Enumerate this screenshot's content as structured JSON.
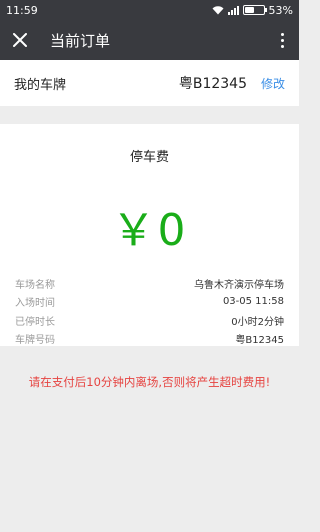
{
  "status_bar": {
    "time": "11:59",
    "battery": "53%",
    "battery_level": 0.53
  },
  "nav": {
    "title": "当前订单"
  },
  "plate": {
    "label": "我的车牌",
    "value": "粤B12345",
    "edit_label": "修改"
  },
  "fee": {
    "title": "停车费",
    "amount": "￥0"
  },
  "details": [
    {
      "label": "车场名称",
      "value": "乌鲁木齐演示停车场"
    },
    {
      "label": "入场时间",
      "value": "03-05 11:58"
    },
    {
      "label": "已停时长",
      "value": "0小时2分钟"
    },
    {
      "label": "车牌号码",
      "value": "粤B12345"
    }
  ],
  "warning": "请在支付后10分钟内离场,否则将产生超时费用!",
  "colors": {
    "header_bg": "#393a3f",
    "amount": "#1aad19",
    "link": "#3a8ee6",
    "warning": "#e64340"
  }
}
